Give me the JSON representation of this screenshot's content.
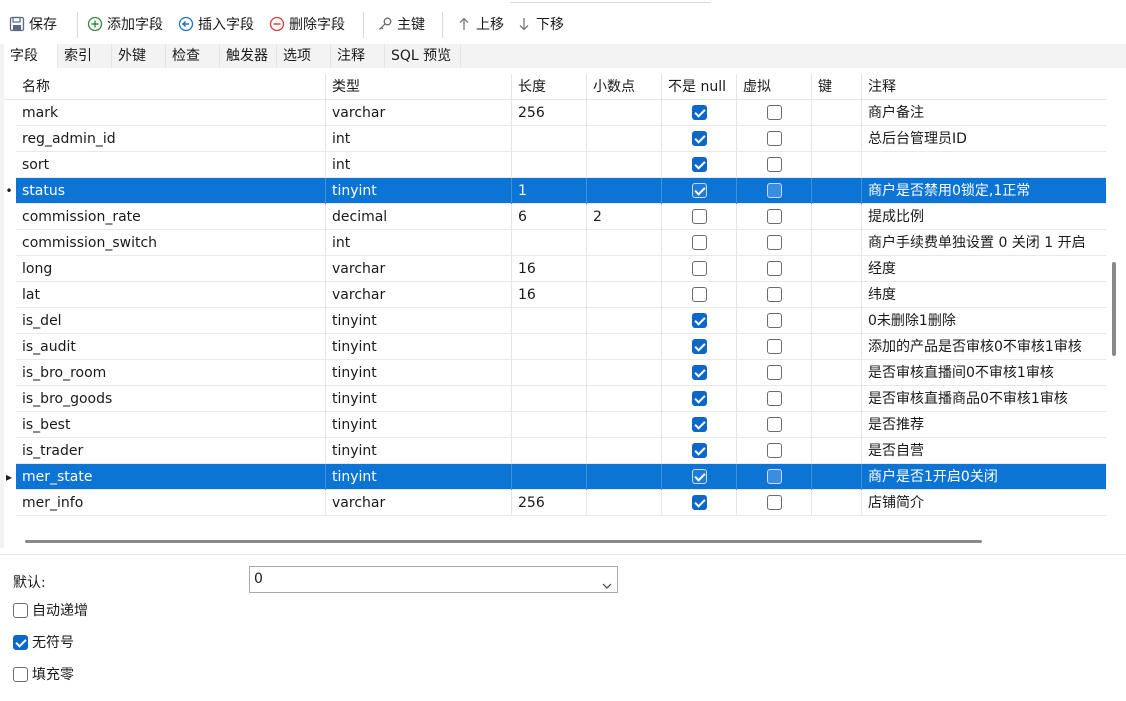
{
  "toolbar": {
    "save": "保存",
    "add_field": "添加字段",
    "insert_field": "插入字段",
    "delete_field": "删除字段",
    "primary_key": "主键",
    "move_up": "上移",
    "move_down": "下移"
  },
  "tabs": [
    "字段",
    "索引",
    "外键",
    "检查",
    "触发器",
    "选项",
    "注释",
    "SQL 预览"
  ],
  "columns": [
    "名称",
    "类型",
    "长度",
    "小数点",
    "不是 null",
    "虚拟",
    "键",
    "注释"
  ],
  "rows": [
    {
      "name": "mark",
      "type": "varchar",
      "length": "256",
      "decimals": "",
      "not_null": true,
      "virtual": false,
      "key": "",
      "comment": "商户备注",
      "selected": false,
      "marker": ""
    },
    {
      "name": "reg_admin_id",
      "type": "int",
      "length": "",
      "decimals": "",
      "not_null": true,
      "virtual": false,
      "key": "",
      "comment": "总后台管理员ID",
      "selected": false,
      "marker": ""
    },
    {
      "name": "sort",
      "type": "int",
      "length": "",
      "decimals": "",
      "not_null": true,
      "virtual": false,
      "key": "",
      "comment": "",
      "selected": false,
      "marker": ""
    },
    {
      "name": "status",
      "type": "tinyint",
      "length": "1",
      "decimals": "",
      "not_null": true,
      "virtual": false,
      "key": "",
      "comment": "商户是否禁用0锁定,1正常",
      "selected": true,
      "marker": "•"
    },
    {
      "name": "commission_rate",
      "type": "decimal",
      "length": "6",
      "decimals": "2",
      "not_null": false,
      "virtual": false,
      "key": "",
      "comment": "提成比例",
      "selected": false,
      "marker": ""
    },
    {
      "name": "commission_switch",
      "type": "int",
      "length": "",
      "decimals": "",
      "not_null": false,
      "virtual": false,
      "key": "",
      "comment": "商户手续费单独设置 0 关闭 1 开启",
      "selected": false,
      "marker": ""
    },
    {
      "name": "long",
      "type": "varchar",
      "length": "16",
      "decimals": "",
      "not_null": false,
      "virtual": false,
      "key": "",
      "comment": "经度",
      "selected": false,
      "marker": ""
    },
    {
      "name": "lat",
      "type": "varchar",
      "length": "16",
      "decimals": "",
      "not_null": false,
      "virtual": false,
      "key": "",
      "comment": "纬度",
      "selected": false,
      "marker": ""
    },
    {
      "name": "is_del",
      "type": "tinyint",
      "length": "",
      "decimals": "",
      "not_null": true,
      "virtual": false,
      "key": "",
      "comment": "0未删除1删除",
      "selected": false,
      "marker": ""
    },
    {
      "name": "is_audit",
      "type": "tinyint",
      "length": "",
      "decimals": "",
      "not_null": true,
      "virtual": false,
      "key": "",
      "comment": "添加的产品是否审核0不审核1审核",
      "selected": false,
      "marker": ""
    },
    {
      "name": "is_bro_room",
      "type": "tinyint",
      "length": "",
      "decimals": "",
      "not_null": true,
      "virtual": false,
      "key": "",
      "comment": "是否审核直播间0不审核1审核",
      "selected": false,
      "marker": ""
    },
    {
      "name": "is_bro_goods",
      "type": "tinyint",
      "length": "",
      "decimals": "",
      "not_null": true,
      "virtual": false,
      "key": "",
      "comment": "是否审核直播商品0不审核1审核",
      "selected": false,
      "marker": ""
    },
    {
      "name": "is_best",
      "type": "tinyint",
      "length": "",
      "decimals": "",
      "not_null": true,
      "virtual": false,
      "key": "",
      "comment": "是否推荐",
      "selected": false,
      "marker": ""
    },
    {
      "name": "is_trader",
      "type": "tinyint",
      "length": "",
      "decimals": "",
      "not_null": true,
      "virtual": false,
      "key": "",
      "comment": "是否自营",
      "selected": false,
      "marker": ""
    },
    {
      "name": "mer_state",
      "type": "tinyint",
      "length": "",
      "decimals": "",
      "not_null": true,
      "virtual": false,
      "key": "",
      "comment": "商户是否1开启0关闭",
      "selected": true,
      "marker": "▸"
    },
    {
      "name": "mer_info",
      "type": "varchar",
      "length": "256",
      "decimals": "",
      "not_null": true,
      "virtual": false,
      "key": "",
      "comment": "店铺简介",
      "selected": false,
      "marker": ""
    }
  ],
  "props": {
    "default_label": "默认:",
    "default_value": "0",
    "auto_increment_label": "自动递增",
    "auto_increment": false,
    "unsigned_label": "无符号",
    "unsigned": true,
    "zerofill_label": "填充零",
    "zerofill": false
  },
  "colors": {
    "accent": "#0c74d4",
    "checkbox_on": "#0c67c9"
  }
}
